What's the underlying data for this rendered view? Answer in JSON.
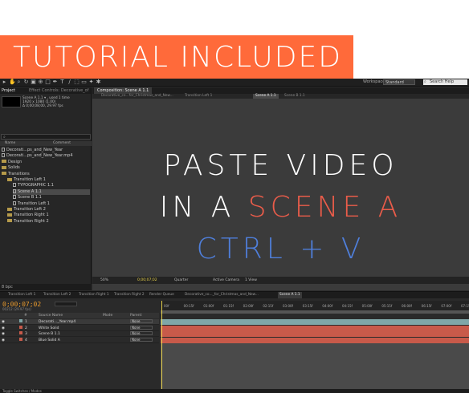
{
  "banner": {
    "text": "TUTORIAL INCLUDED",
    "color": "#ff6a3a"
  },
  "toolbar": {
    "workspace_label": "Workspace:",
    "workspace_value": "Standard",
    "search_placeholder": "Search Help"
  },
  "project": {
    "tab": "Project",
    "tab2": "Effect Controls: Decorative_of",
    "info": [
      "Scene A 1.1 ▾ , used 1 time",
      "1920 x 1080 (1.00)",
      "Δ 0;00;08;00, 29.97 fps"
    ],
    "columns": [
      "Name",
      "Comment"
    ],
    "items": [
      {
        "label": "Decorati...ps_and_New_Year",
        "kind": "file",
        "indent": 0
      },
      {
        "label": "Decorati...ps_and_New_Year.mp4",
        "kind": "file",
        "indent": 0
      },
      {
        "label": "Design",
        "kind": "folder",
        "indent": 0
      },
      {
        "label": "Solids",
        "kind": "folder",
        "indent": 0
      },
      {
        "label": "Transitions",
        "kind": "folder",
        "indent": 0
      },
      {
        "label": "Transition Left 1",
        "kind": "folder",
        "indent": 1
      },
      {
        "label": "TYPOGRAPHIC 1.1",
        "kind": "file",
        "indent": 2
      },
      {
        "label": "Scene A 1.1",
        "kind": "file",
        "indent": 2,
        "selected": true
      },
      {
        "label": "Scene B 1.1",
        "kind": "file",
        "indent": 2
      },
      {
        "label": "Transition Left 1",
        "kind": "file",
        "indent": 2
      },
      {
        "label": "Transition Left 2",
        "kind": "folder",
        "indent": 1
      },
      {
        "label": "Transition Right 1",
        "kind": "folder",
        "indent": 1
      },
      {
        "label": "Transition Right 2",
        "kind": "folder",
        "indent": 1
      }
    ],
    "bpc": "8 bpc"
  },
  "composition": {
    "tab": "Composition: Scene A 1.1",
    "crumbs": [
      "Decorative_co...for_Christmas_and_New...",
      "Transition Left 1",
      "Scene A 1.1",
      "Scene B 1.1"
    ],
    "active_crumb": 2,
    "overlay": {
      "line1": "PASTE VIDEO",
      "line2_a": "IN A ",
      "line2_b": "SCENE A",
      "line3": "CTRL + V"
    },
    "overlay_colors": {
      "white": "#ffffff",
      "red": "#ea5c4a",
      "blue": "#4f7fdb"
    },
    "viewer_bar": {
      "zoom": "50%",
      "timecode": "0;00;07;02",
      "quality": "Quarter",
      "camera": "Active Camera",
      "views": "1 View"
    }
  },
  "timeline": {
    "tabs": [
      "Transition Left 1",
      "Transition Left 2",
      "Transition Right 1",
      "Transition Right 2",
      "Render Queue",
      "Decorative_co..._for_Christmas_and_New...",
      "Scene A 1.1"
    ],
    "active_tab": 6,
    "timecode": "0;00;07;02",
    "fps_text": "00212 (29.97 fps)",
    "columns": [
      "#",
      "Source Name",
      "Mode",
      "Parent"
    ],
    "layers": [
      {
        "num": "1",
        "name": "Decorati..._Year.mp4",
        "color": "#7fa7a8",
        "selected": true,
        "mode": "None"
      },
      {
        "num": "2",
        "name": "White Solid",
        "color": "#c85a4a",
        "mode": "None"
      },
      {
        "num": "3",
        "name": "Scene B 1.1",
        "color": "#c85a4a",
        "mode": "None"
      },
      {
        "num": "4",
        "name": "Blue Solid A",
        "color": "#c85a4a",
        "mode": "None"
      }
    ],
    "ruler_ticks": [
      "00f",
      "00:15f",
      "01:00f",
      "01:15f",
      "02:00f",
      "02:15f",
      "03:00f",
      "03:15f",
      "04:00f",
      "04:15f",
      "05:00f",
      "05:15f",
      "06:00f",
      "06:15f",
      "07:00f",
      "07:15f"
    ],
    "bottom": "Toggle Switches / Modes"
  }
}
